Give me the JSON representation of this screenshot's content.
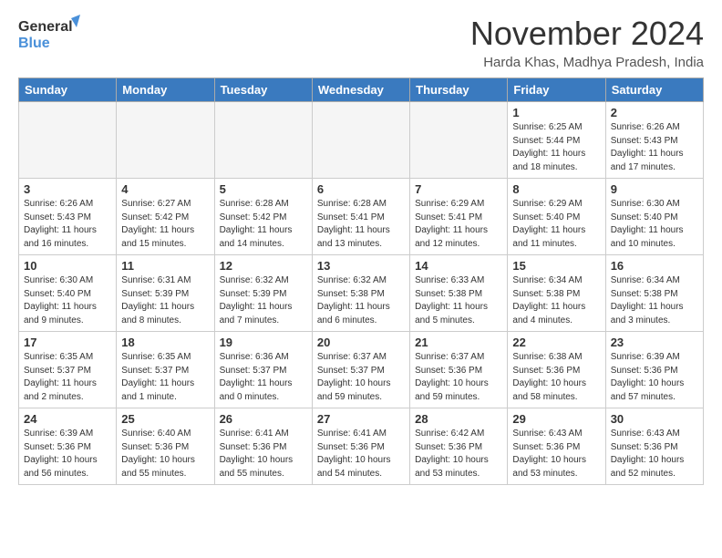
{
  "header": {
    "logo_line1": "General",
    "logo_line2": "Blue",
    "month": "November 2024",
    "location": "Harda Khas, Madhya Pradesh, India"
  },
  "weekdays": [
    "Sunday",
    "Monday",
    "Tuesday",
    "Wednesday",
    "Thursday",
    "Friday",
    "Saturday"
  ],
  "weeks": [
    [
      {
        "day": "",
        "empty": true
      },
      {
        "day": "",
        "empty": true
      },
      {
        "day": "",
        "empty": true
      },
      {
        "day": "",
        "empty": true
      },
      {
        "day": "",
        "empty": true
      },
      {
        "day": "1",
        "sunrise": "Sunrise: 6:25 AM",
        "sunset": "Sunset: 5:44 PM",
        "daylight": "Daylight: 11 hours and 18 minutes."
      },
      {
        "day": "2",
        "sunrise": "Sunrise: 6:26 AM",
        "sunset": "Sunset: 5:43 PM",
        "daylight": "Daylight: 11 hours and 17 minutes."
      }
    ],
    [
      {
        "day": "3",
        "sunrise": "Sunrise: 6:26 AM",
        "sunset": "Sunset: 5:43 PM",
        "daylight": "Daylight: 11 hours and 16 minutes."
      },
      {
        "day": "4",
        "sunrise": "Sunrise: 6:27 AM",
        "sunset": "Sunset: 5:42 PM",
        "daylight": "Daylight: 11 hours and 15 minutes."
      },
      {
        "day": "5",
        "sunrise": "Sunrise: 6:28 AM",
        "sunset": "Sunset: 5:42 PM",
        "daylight": "Daylight: 11 hours and 14 minutes."
      },
      {
        "day": "6",
        "sunrise": "Sunrise: 6:28 AM",
        "sunset": "Sunset: 5:41 PM",
        "daylight": "Daylight: 11 hours and 13 minutes."
      },
      {
        "day": "7",
        "sunrise": "Sunrise: 6:29 AM",
        "sunset": "Sunset: 5:41 PM",
        "daylight": "Daylight: 11 hours and 12 minutes."
      },
      {
        "day": "8",
        "sunrise": "Sunrise: 6:29 AM",
        "sunset": "Sunset: 5:40 PM",
        "daylight": "Daylight: 11 hours and 11 minutes."
      },
      {
        "day": "9",
        "sunrise": "Sunrise: 6:30 AM",
        "sunset": "Sunset: 5:40 PM",
        "daylight": "Daylight: 11 hours and 10 minutes."
      }
    ],
    [
      {
        "day": "10",
        "sunrise": "Sunrise: 6:30 AM",
        "sunset": "Sunset: 5:40 PM",
        "daylight": "Daylight: 11 hours and 9 minutes."
      },
      {
        "day": "11",
        "sunrise": "Sunrise: 6:31 AM",
        "sunset": "Sunset: 5:39 PM",
        "daylight": "Daylight: 11 hours and 8 minutes."
      },
      {
        "day": "12",
        "sunrise": "Sunrise: 6:32 AM",
        "sunset": "Sunset: 5:39 PM",
        "daylight": "Daylight: 11 hours and 7 minutes."
      },
      {
        "day": "13",
        "sunrise": "Sunrise: 6:32 AM",
        "sunset": "Sunset: 5:38 PM",
        "daylight": "Daylight: 11 hours and 6 minutes."
      },
      {
        "day": "14",
        "sunrise": "Sunrise: 6:33 AM",
        "sunset": "Sunset: 5:38 PM",
        "daylight": "Daylight: 11 hours and 5 minutes."
      },
      {
        "day": "15",
        "sunrise": "Sunrise: 6:34 AM",
        "sunset": "Sunset: 5:38 PM",
        "daylight": "Daylight: 11 hours and 4 minutes."
      },
      {
        "day": "16",
        "sunrise": "Sunrise: 6:34 AM",
        "sunset": "Sunset: 5:38 PM",
        "daylight": "Daylight: 11 hours and 3 minutes."
      }
    ],
    [
      {
        "day": "17",
        "sunrise": "Sunrise: 6:35 AM",
        "sunset": "Sunset: 5:37 PM",
        "daylight": "Daylight: 11 hours and 2 minutes."
      },
      {
        "day": "18",
        "sunrise": "Sunrise: 6:35 AM",
        "sunset": "Sunset: 5:37 PM",
        "daylight": "Daylight: 11 hours and 1 minute."
      },
      {
        "day": "19",
        "sunrise": "Sunrise: 6:36 AM",
        "sunset": "Sunset: 5:37 PM",
        "daylight": "Daylight: 11 hours and 0 minutes."
      },
      {
        "day": "20",
        "sunrise": "Sunrise: 6:37 AM",
        "sunset": "Sunset: 5:37 PM",
        "daylight": "Daylight: 10 hours and 59 minutes."
      },
      {
        "day": "21",
        "sunrise": "Sunrise: 6:37 AM",
        "sunset": "Sunset: 5:36 PM",
        "daylight": "Daylight: 10 hours and 59 minutes."
      },
      {
        "day": "22",
        "sunrise": "Sunrise: 6:38 AM",
        "sunset": "Sunset: 5:36 PM",
        "daylight": "Daylight: 10 hours and 58 minutes."
      },
      {
        "day": "23",
        "sunrise": "Sunrise: 6:39 AM",
        "sunset": "Sunset: 5:36 PM",
        "daylight": "Daylight: 10 hours and 57 minutes."
      }
    ],
    [
      {
        "day": "24",
        "sunrise": "Sunrise: 6:39 AM",
        "sunset": "Sunset: 5:36 PM",
        "daylight": "Daylight: 10 hours and 56 minutes."
      },
      {
        "day": "25",
        "sunrise": "Sunrise: 6:40 AM",
        "sunset": "Sunset: 5:36 PM",
        "daylight": "Daylight: 10 hours and 55 minutes."
      },
      {
        "day": "26",
        "sunrise": "Sunrise: 6:41 AM",
        "sunset": "Sunset: 5:36 PM",
        "daylight": "Daylight: 10 hours and 55 minutes."
      },
      {
        "day": "27",
        "sunrise": "Sunrise: 6:41 AM",
        "sunset": "Sunset: 5:36 PM",
        "daylight": "Daylight: 10 hours and 54 minutes."
      },
      {
        "day": "28",
        "sunrise": "Sunrise: 6:42 AM",
        "sunset": "Sunset: 5:36 PM",
        "daylight": "Daylight: 10 hours and 53 minutes."
      },
      {
        "day": "29",
        "sunrise": "Sunrise: 6:43 AM",
        "sunset": "Sunset: 5:36 PM",
        "daylight": "Daylight: 10 hours and 53 minutes."
      },
      {
        "day": "30",
        "sunrise": "Sunrise: 6:43 AM",
        "sunset": "Sunset: 5:36 PM",
        "daylight": "Daylight: 10 hours and 52 minutes."
      }
    ]
  ]
}
